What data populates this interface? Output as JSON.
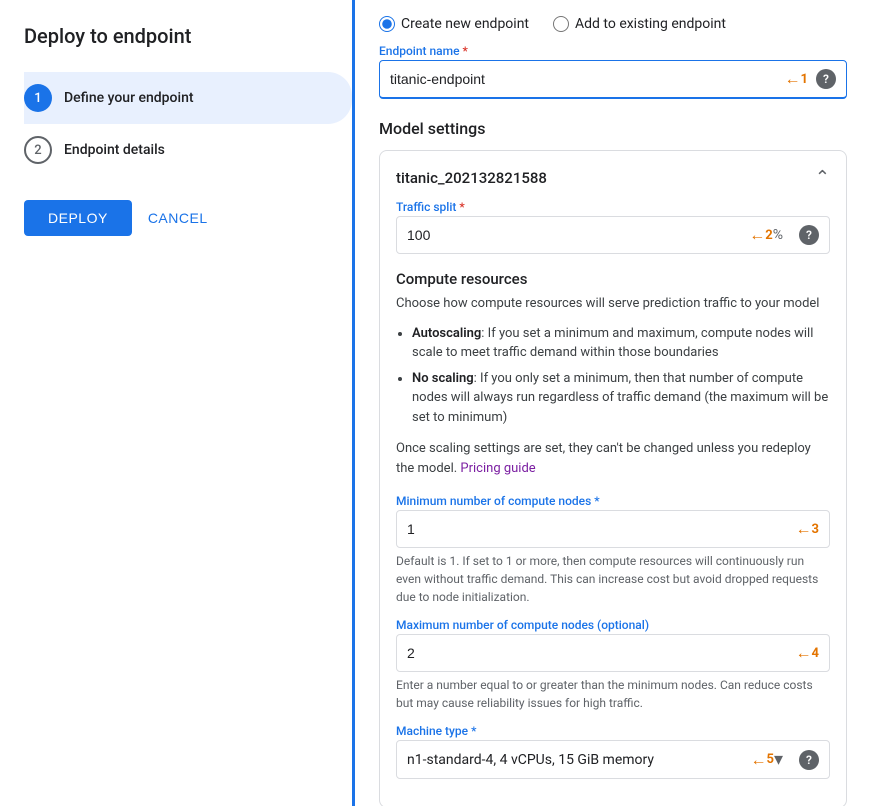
{
  "sidebar": {
    "title": "Deploy to endpoint",
    "steps": [
      {
        "number": "1",
        "label": "Define your endpoint",
        "active": true
      },
      {
        "number": "2",
        "label": "Endpoint details",
        "active": false
      }
    ],
    "deploy_label": "DEPLOY",
    "cancel_label": "CANCEL"
  },
  "main": {
    "radio_options": [
      {
        "id": "create-new",
        "label": "Create new endpoint",
        "checked": true
      },
      {
        "id": "add-existing",
        "label": "Add to existing endpoint",
        "checked": false
      }
    ],
    "endpoint_name": {
      "label": "Endpoint name",
      "required": true,
      "value": "titanic-endpoint",
      "annotation_num": "1"
    },
    "model_settings_title": "Model settings",
    "model_card": {
      "name": "titanic_202132821588",
      "traffic_split": {
        "label": "Traffic split",
        "required": true,
        "value": "100",
        "suffix": "%",
        "annotation_num": "2"
      }
    },
    "compute_resources": {
      "title": "Compute resources",
      "description": "Choose how compute resources will serve prediction traffic to your model",
      "bullets": [
        {
          "bold": "Autoscaling",
          "text": ": If you set a minimum and maximum, compute nodes will scale to meet traffic demand within those boundaries"
        },
        {
          "bold": "No scaling",
          "text": ": If you only set a minimum, then that number of compute nodes will always run regardless of traffic demand (the maximum will be set to minimum)"
        }
      ],
      "scaling_note": "Once scaling settings are set, they can't be changed unless you redeploy the model.",
      "pricing_link_text": "Pricing guide",
      "min_nodes": {
        "label": "Minimum number of compute nodes",
        "required": true,
        "value": "1",
        "annotation_num": "3",
        "hint": "Default is 1. If set to 1 or more, then compute resources will continuously run even without traffic demand. This can increase cost but avoid dropped requests due to node initialization."
      },
      "max_nodes": {
        "label": "Maximum number of compute nodes (optional)",
        "value": "2",
        "annotation_num": "4",
        "hint": "Enter a number equal to or greater than the minimum nodes. Can reduce costs but may cause reliability issues for high traffic."
      },
      "machine_type": {
        "label": "Machine type",
        "required": true,
        "value": "n1-standard-4, 4 vCPUs, 15 GiB memory",
        "annotation_num": "5"
      }
    }
  }
}
